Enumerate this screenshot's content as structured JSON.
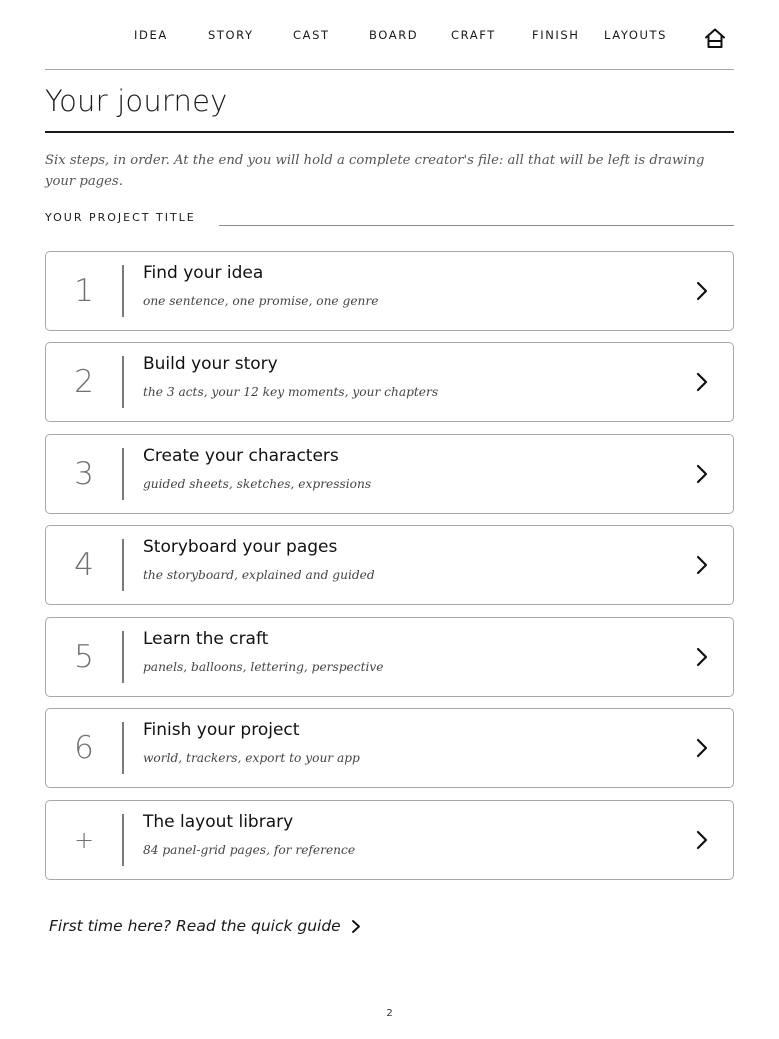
{
  "nav": {
    "items": [
      {
        "label": "IDEA"
      },
      {
        "label": "STORY"
      },
      {
        "label": "CAST"
      },
      {
        "label": "BOARD"
      },
      {
        "label": "CRAFT"
      },
      {
        "label": "FINISH"
      },
      {
        "label": "LAYOUTS"
      }
    ],
    "home_icon": "home-icon"
  },
  "page": {
    "title": "Your journey",
    "intro": "Six steps, in order. At the end you will hold a complete creator's file: all that will be left is drawing your pages.",
    "project_label": "YOUR PROJECT TITLE",
    "project_value": ""
  },
  "steps": [
    {
      "number": "1",
      "title": "Find your idea",
      "subtitle": "one sentence, one promise, one genre"
    },
    {
      "number": "2",
      "title": "Build your story",
      "subtitle": "the 3 acts, your 12 key moments, your chapters"
    },
    {
      "number": "3",
      "title": "Create your characters",
      "subtitle": "guided sheets, sketches, expressions"
    },
    {
      "number": "4",
      "title": "Storyboard your pages",
      "subtitle": "the storyboard, explained and guided"
    },
    {
      "number": "5",
      "title": "Learn the craft",
      "subtitle": "panels, balloons, lettering, perspective"
    },
    {
      "number": "6",
      "title": "Finish your project",
      "subtitle": "world, trackers, export to your app"
    },
    {
      "number": "+",
      "title": "The layout library",
      "subtitle": "84 panel-grid pages, for reference"
    }
  ],
  "guide": {
    "label": "First time here? Read the quick guide"
  },
  "page_number": "2",
  "icons": {
    "chevron": "chevron-right-icon",
    "home": "home-icon"
  },
  "colors": {
    "text": "#1a1a1a",
    "border": "#a9a9a9",
    "muted": "#707070"
  }
}
